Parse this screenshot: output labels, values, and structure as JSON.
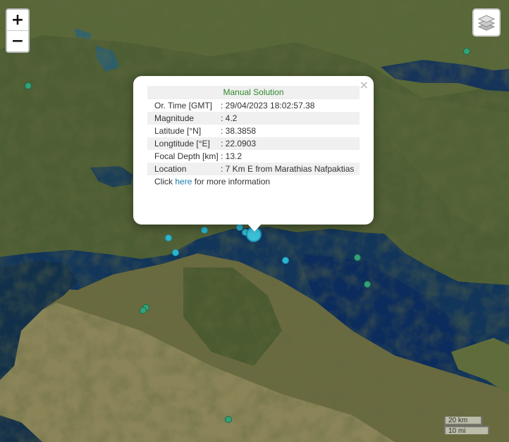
{
  "map": {
    "colors": {
      "land_dark": "#45552e",
      "land_mid": "#5f6e3c",
      "land_light": "#8b8a5e",
      "water": "#14304a",
      "water_deep": "#0c2c58"
    }
  },
  "controls": {
    "zoom_in": "+",
    "zoom_out": "−",
    "layers_icon": "layers-icon"
  },
  "markers": [
    {
      "color": "green",
      "label": "marker"
    },
    {
      "color": "green",
      "label": "marker"
    },
    {
      "color": "cyan",
      "label": "marker"
    },
    {
      "color": "cyan",
      "label": "marker"
    },
    {
      "color": "cyan",
      "label": "marker"
    },
    {
      "color": "cyan",
      "label": "marker"
    },
    {
      "color": "cyan",
      "label": "marker"
    },
    {
      "color": "cyan",
      "label": "marker"
    },
    {
      "color": "green",
      "label": "marker"
    },
    {
      "color": "green",
      "label": "marker"
    },
    {
      "color": "green",
      "label": "marker"
    },
    {
      "color": "green",
      "label": "marker"
    },
    {
      "color": "green",
      "label": "marker"
    }
  ],
  "popup": {
    "close": "×",
    "header": "Manual Solution",
    "rows": [
      {
        "label": "Or. Time [GMT]",
        "value": ": 29/04/2023 18:02:57.38"
      },
      {
        "label": "Magnitude",
        "value": ": 4.2"
      },
      {
        "label": "Latitude [°N]",
        "value": ": 38.3858"
      },
      {
        "label": "Longtitude [°E]",
        "value": ": 22.0903"
      },
      {
        "label": "Focal Depth [km]",
        "value": ": 13.2"
      },
      {
        "label": "Location",
        "value": ": 7 Km E from Marathias Nafpaktias"
      }
    ],
    "more_prefix": "Click ",
    "more_link": "here",
    "more_suffix": " for more information"
  },
  "scale": {
    "km": "20 km",
    "mi": "10 mi"
  }
}
